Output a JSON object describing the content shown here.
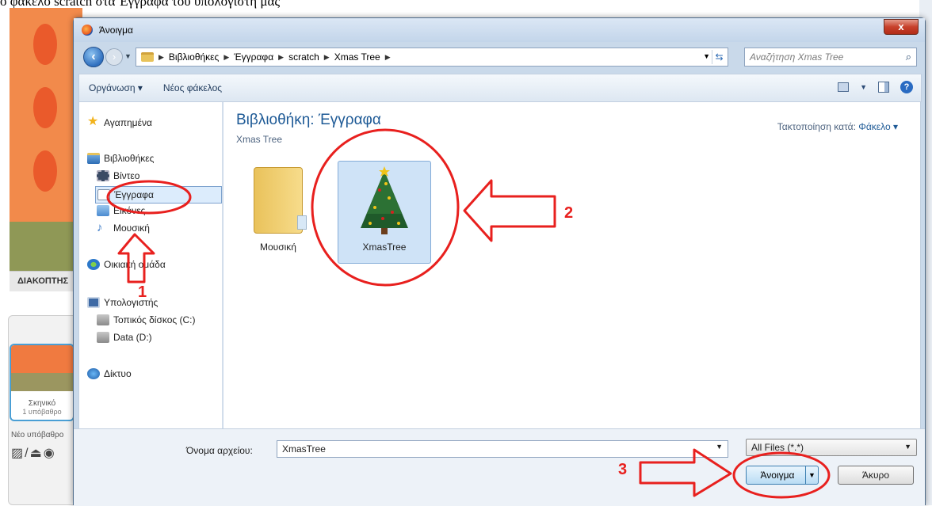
{
  "background": {
    "caption": "ο φάκελο scratch στα Έγγραφα του υπολογιστή μας",
    "stop_label": "ΔΙΑΚΟΠΤΗΣ",
    "stage_label": "Σκηνικό",
    "stage_sub": "1 υπόβαθρο",
    "new_backdrop": "Νέο υπόβαθρο"
  },
  "dialog": {
    "title": "Άνοιγμα",
    "close_glyph": "x",
    "breadcrumb": [
      "Βιβλιοθήκες",
      "Έγγραφα",
      "scratch",
      "Xmas Tree"
    ],
    "search_placeholder": "Αναζήτηση Xmas Tree",
    "toolbar": {
      "organize": "Οργάνωση ▾",
      "new_folder": "Νέος φάκελος"
    },
    "nav": {
      "favorites": "Αγαπημένα",
      "libraries": "Βιβλιοθήκες",
      "videos": "Βίντεο",
      "documents": "Έγγραφα",
      "pictures": "Εικόνες",
      "music": "Μουσική",
      "homegroup": "Οικιακή ομάδα",
      "computer": "Υπολογιστής",
      "local_disk": "Τοπικός δίσκος (C:)",
      "data_disk": "Data (D:)",
      "network": "Δίκτυο"
    },
    "content": {
      "library_title": "Βιβλιοθήκη: Έγγραφα",
      "library_sub": "Xmas Tree",
      "arrange_label": "Τακτοποίηση κατά:",
      "arrange_value": "Φάκελο ▾",
      "files": [
        "Μουσική",
        "XmasTree"
      ]
    },
    "footer": {
      "filename_label": "Όνομα αρχείου:",
      "filename_value": "XmasTree",
      "filter_value": "All Files (*.*)",
      "open_label": "Άνοιγμα",
      "cancel_label": "Άκυρο"
    }
  },
  "annotations": {
    "step1": "1",
    "step2": "2",
    "step3": "3",
    "color": "#e8201e"
  }
}
